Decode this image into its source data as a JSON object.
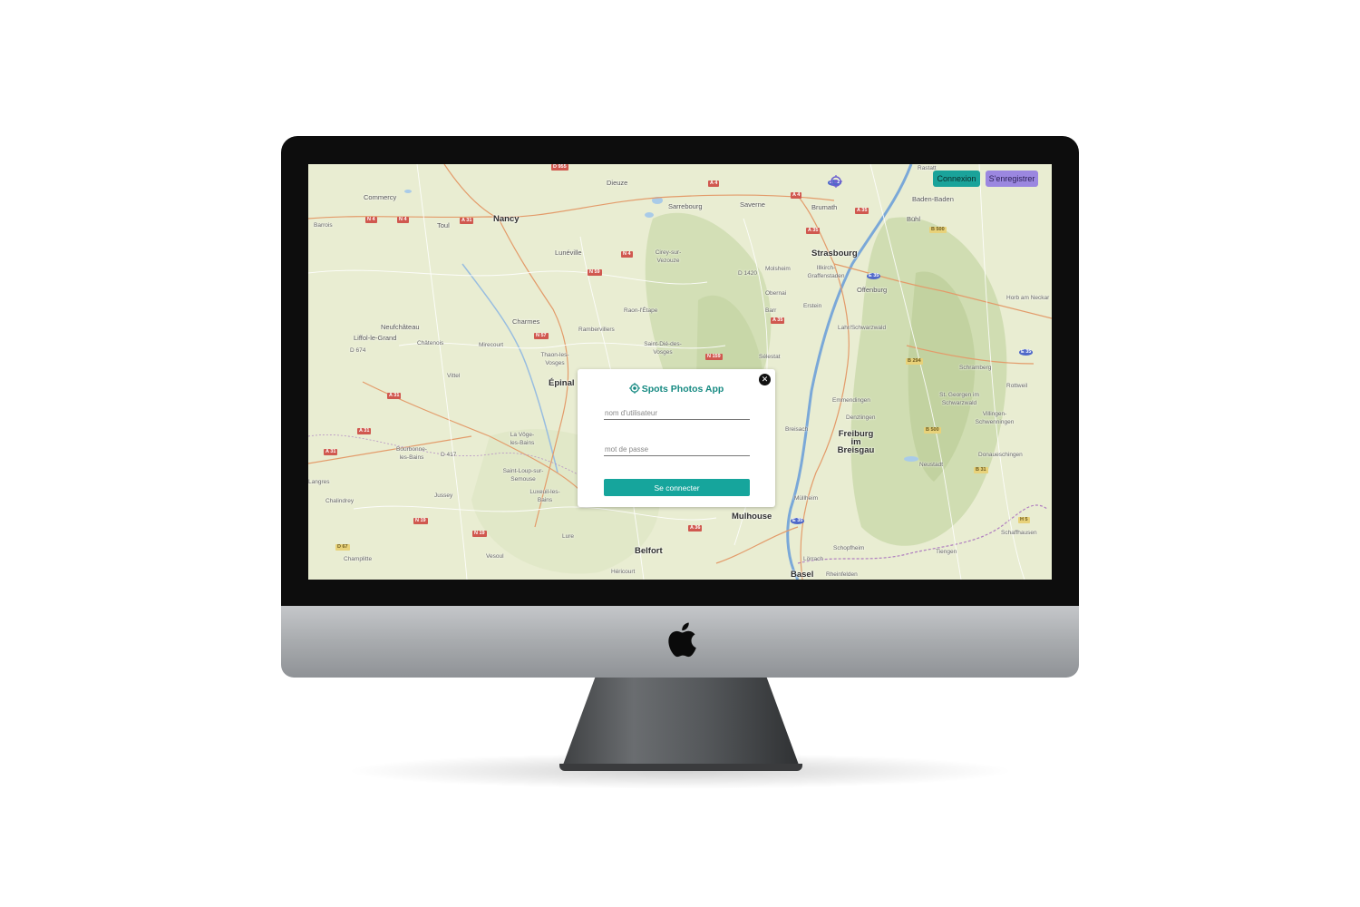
{
  "app": {
    "title": "Spots Photos App"
  },
  "header": {
    "login_label": "Connexion",
    "register_label": "S'enregistrer"
  },
  "login_modal": {
    "close_symbol": "✕",
    "username_placeholder": "nom d'utilisateur",
    "password_placeholder": "mot de passe",
    "submit_label": "Se connecter"
  },
  "map": {
    "places": [
      "Commercy",
      "Nancy",
      "Toul",
      "Dieuze",
      "Sarrebourg",
      "Saverne",
      "Brumath",
      "Rastatt",
      "Baden-Baden",
      "Bühl",
      "Lunéville",
      "Cirey-sur-Vezouze",
      "Strasbourg",
      "Molsheim",
      "Illkirch-Graffenstaden",
      "Offenburg",
      "Obernai",
      "Neufchâteau",
      "Liffol-le-Grand",
      "Châtenois",
      "Charmes",
      "Rambervillers",
      "Raon-l'Étape",
      "Barr",
      "Erstein",
      "Horb am Neckar",
      "Mirecourt",
      "Saint-Dié-des-Vosges",
      "Sélestat",
      "Lahr/Schwarzwald",
      "Thaon-les-Vosges",
      "Schramberg",
      "Vittel",
      "Épinal",
      "Rottweil",
      "St. Georgen im Schwarzwald",
      "Villingen-Schwenningen",
      "Emmendingen",
      "Denzlingen",
      "Breisach",
      "Freiburg im Breisgau",
      "Bourbonne-les-Bains",
      "La Vôge-les-Bains",
      "Donaueschingen",
      "Neustadt",
      "Langres",
      "Saint-Loup-sur-Semouse",
      "Luxeuil-les-Bains",
      "Jussey",
      "Chalindrey",
      "Müllheim",
      "Mulhouse",
      "Schaffhausen",
      "Lure",
      "Belfort",
      "Champlitte",
      "Vesoul",
      "Héricourt",
      "Schopfheim",
      "Tiengen",
      "Lörrach",
      "Basel",
      "Rheinfelden",
      "Barrois"
    ],
    "roads": [
      "D 955",
      "N 4",
      "A 4",
      "A 35",
      "A 31",
      "N 59",
      "D 1420",
      "N 57",
      "N 159",
      "D 674",
      "D 417",
      "N 19",
      "D 67",
      "A 36",
      "B 500",
      "B 294",
      "B 31",
      "E 35",
      "E 52",
      "H 5"
    ]
  },
  "colors": {
    "accent_teal": "#16a59c",
    "accent_purple": "#9b87e0",
    "title_teal": "#168a82"
  }
}
